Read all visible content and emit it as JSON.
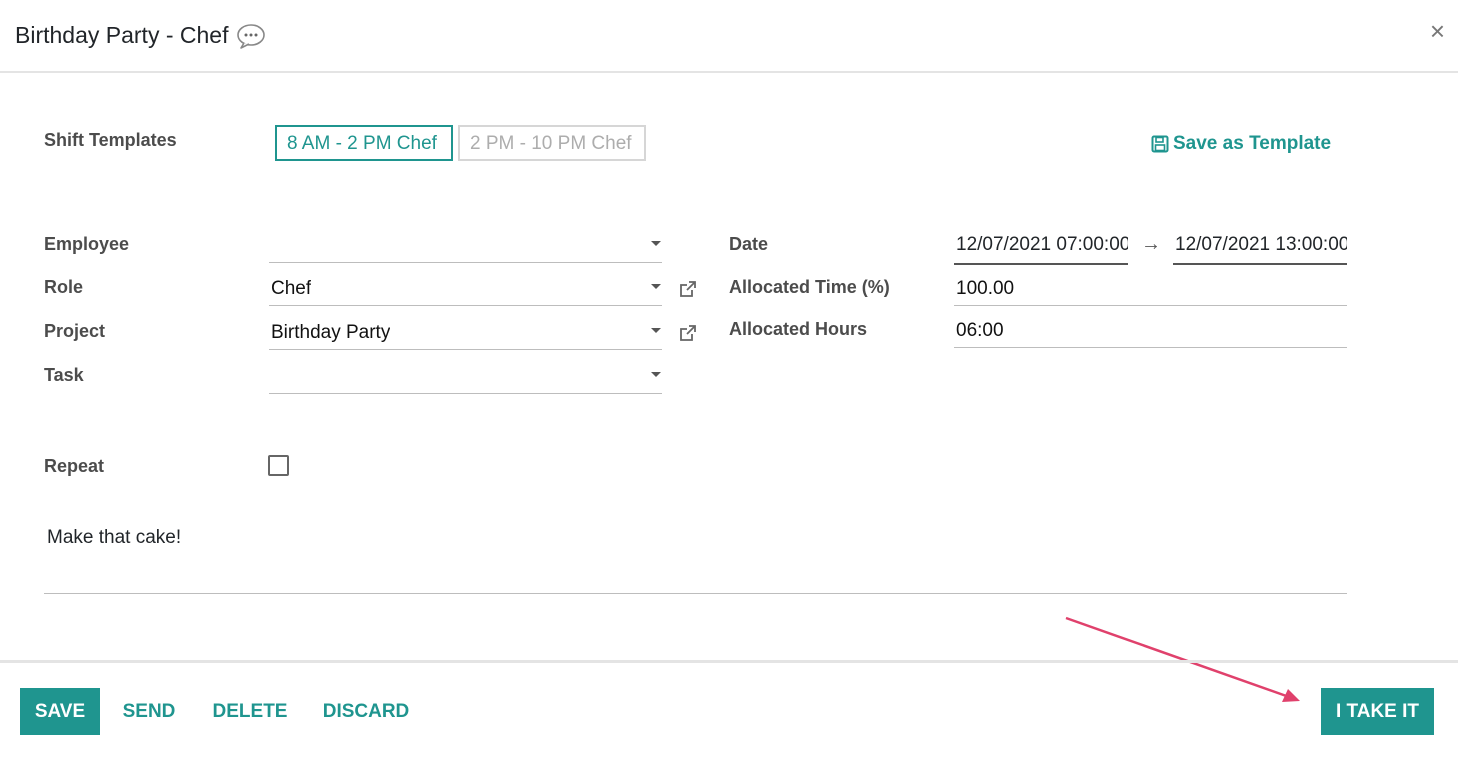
{
  "dialog": {
    "title": "Birthday Party - Chef",
    "close_glyph": "×"
  },
  "templates": {
    "label": "Shift Templates",
    "items": [
      "8 AM - 2 PM Chef",
      "2 PM - 10 PM Chef"
    ],
    "save_label": "Save as Template"
  },
  "form": {
    "employee_label": "Employee",
    "employee_value": "",
    "role_label": "Role",
    "role_value": "Chef",
    "project_label": "Project",
    "project_value": "Birthday Party",
    "task_label": "Task",
    "task_value": "",
    "date_label": "Date",
    "date_start": "12/07/2021 07:00:00",
    "date_end": "12/07/2021 13:00:00",
    "date_arrow": "→",
    "alloc_time_label": "Allocated Time (%)",
    "alloc_time_value": "100.00",
    "alloc_hours_label": "Allocated Hours",
    "alloc_hours_value": "06:00",
    "repeat_label": "Repeat",
    "note": "Make that cake!"
  },
  "footer": {
    "save": "Save",
    "send": "Send",
    "delete": "Delete",
    "discard": "Discard",
    "take": "I Take It"
  },
  "colors": {
    "accent": "#1f958f",
    "arrow_annotation": "#e0416c"
  }
}
